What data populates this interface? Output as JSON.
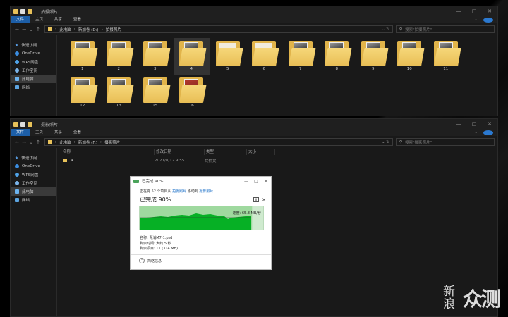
{
  "top_window": {
    "title": "拍摄照片",
    "tabs": [
      "文件",
      "主页",
      "共享",
      "查看"
    ],
    "address": [
      "此电脑",
      "新加卷 (D:)",
      "拍摄照片"
    ],
    "search_placeholder": "搜索\"拍摄照片\"",
    "folders": [
      "1",
      "2",
      "3",
      "4",
      "5",
      "6",
      "7",
      "8",
      "9",
      "10",
      "11",
      "12",
      "13",
      "15",
      "16"
    ],
    "selected_folder": "4"
  },
  "bottom_window": {
    "title": "摄影照片",
    "tabs": [
      "文件",
      "主页",
      "共享",
      "查看"
    ],
    "address": [
      "此电脑",
      "新加卷 (F:)",
      "摄影照片"
    ],
    "search_placeholder": "搜索\"摄影照片\"",
    "columns": {
      "name": "名称",
      "date": "修改日期",
      "type": "类型",
      "size": "大小"
    },
    "rows": [
      {
        "name": "4",
        "date": "2021/8/12 9:55",
        "type": "文件夹"
      }
    ]
  },
  "sidebar": {
    "items": [
      "快速访问",
      "OneDrive",
      "WPS网盘",
      "工作空间",
      "此电脑",
      "网络"
    ],
    "selected": "此电脑"
  },
  "copy_dialog": {
    "title": "已完成 90%",
    "subtitle_prefix": "正在将 52 个项目从",
    "source": "拍摄照片",
    "subtitle_mid": "移动到",
    "destination": "摄影照片",
    "big_status": "已完成 90%",
    "speed": "速度: 65.8 MB/秒",
    "filename": "名称: 青浦M7-1.psd",
    "time_left": "剩余时间: 大约 5 秒",
    "items_left": "剩余项目: 11 (314 MB)",
    "details_label": "简略信息",
    "progress_fraction": 0.9
  },
  "watermark": {
    "line1": "新",
    "line2": "浪",
    "big": "众测"
  },
  "colors": {
    "accent": "#1d5fa8",
    "progress_green": "#06b025",
    "folder": "#e8c25a"
  }
}
